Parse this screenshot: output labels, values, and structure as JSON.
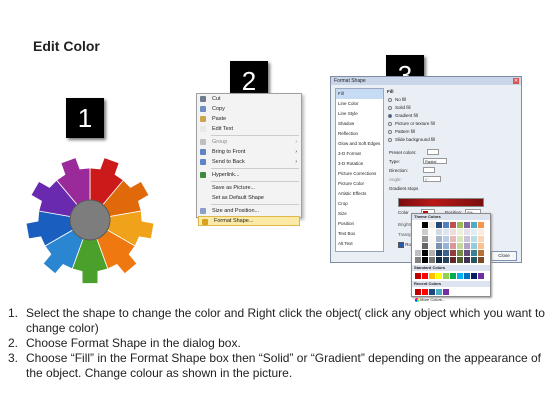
{
  "title": "Edit Color",
  "badges": [
    "1",
    "2",
    "3"
  ],
  "context_menu": {
    "items": [
      {
        "label": "Cut",
        "icon": "scissors-icon",
        "color": "#6f7b91",
        "disabled": false
      },
      {
        "label": "Copy",
        "icon": "copy-icon",
        "color": "#6f8fc2",
        "disabled": false
      },
      {
        "label": "Paste",
        "icon": "paste-icon",
        "color": "#caa54b",
        "disabled": false
      },
      {
        "label": "Edit Text",
        "icon": "edit-text-icon",
        "color": "#e8e8e8",
        "disabled": false
      },
      {
        "label": "Group",
        "icon": "group-icon",
        "color": "#bfbfbf",
        "disabled": true,
        "submenu": true
      },
      {
        "label": "Bring to Front",
        "icon": "bring-front-icon",
        "color": "#5f84c7",
        "disabled": false,
        "submenu": true
      },
      {
        "label": "Send to Back",
        "icon": "send-back-icon",
        "color": "#5f84c7",
        "disabled": false,
        "submenu": true
      },
      {
        "label": "Hyperlink...",
        "icon": "hyperlink-icon",
        "color": "#3c8a3c",
        "disabled": false
      },
      {
        "label": "Save as Picture...",
        "icon": "",
        "color": "",
        "disabled": false
      },
      {
        "label": "Set as Default Shape",
        "icon": "",
        "color": "",
        "disabled": false
      },
      {
        "label": "Size and Position...",
        "icon": "size-icon",
        "color": "#8aa0c8",
        "disabled": false
      },
      {
        "label": "Format Shape...",
        "icon": "format-shape-icon",
        "color": "#d9a11f",
        "disabled": false,
        "selected": true
      }
    ]
  },
  "dialog": {
    "title": "Format Shape",
    "categories": [
      "Fill",
      "Line Color",
      "Line Style",
      "Shadow",
      "Reflection",
      "Glow and Soft Edges",
      "3-D Format",
      "3-D Rotation",
      "Picture Corrections",
      "Picture Color",
      "Artistic Effects",
      "Crop",
      "Size",
      "Position",
      "Text Box",
      "Alt Text"
    ],
    "fill_header": "Fill",
    "fill_options": [
      {
        "label": "No fill",
        "on": false
      },
      {
        "label": "Solid fill",
        "on": false
      },
      {
        "label": "Gradient fill",
        "on": true
      },
      {
        "label": "Picture or texture fill",
        "on": false
      },
      {
        "label": "Pattern fill",
        "on": false
      },
      {
        "label": "Slide background fill",
        "on": false
      }
    ],
    "preset_label": "Preset colors:",
    "type_label": "Type:",
    "type_value": "Radial",
    "direction_label": "Direction:",
    "angle_label": "Angle:",
    "angle_value": "0°",
    "stops_label": "Gradient stops",
    "color_label": "Color",
    "position_label": "Position:",
    "position_value": "0%",
    "brightness_label": "Brightness:",
    "transparency_label": "Transparency:",
    "rotate_label": "Rotate",
    "close_label": "Close"
  },
  "palette": {
    "theme_label": "Theme Colors",
    "standard_label": "Standard Colors",
    "recent_label": "Recent Colors",
    "more_label": "More Colors...",
    "theme_top": [
      "#ffffff",
      "#000000",
      "#eeece1",
      "#1f497d",
      "#4f81bd",
      "#c0504d",
      "#9bbb59",
      "#8064a2",
      "#4bacc6",
      "#f79646"
    ],
    "standard": [
      "#c00000",
      "#ff0000",
      "#ffc000",
      "#ffff00",
      "#92d050",
      "#00b050",
      "#00b0f0",
      "#0070c0",
      "#002060",
      "#7030a0"
    ],
    "recent": [
      "#c00000",
      "#ff0000",
      "#1f497d",
      "#4bacc6",
      "#7030a0"
    ]
  },
  "instructions": [
    {
      "num": "1.",
      "text": "Select the shape to change the color and Right click the object( click any object which you want to change color)"
    },
    {
      "num": "2.",
      "text": "Choose Format Shape in the dialog box."
    },
    {
      "num": "3.",
      "text": "Choose “Fill” in the Format Shape box then “Solid” or “Gradient” depending on the appearance of the object. Change colour as shown in the picture."
    }
  ],
  "gear_colors": [
    "#cc1a1a",
    "#e06a0a",
    "#f0a21a",
    "#f07810",
    "#4aa02a",
    "#2a86d0",
    "#1a5ec0",
    "#6a2ab0",
    "#9a2a9a"
  ]
}
